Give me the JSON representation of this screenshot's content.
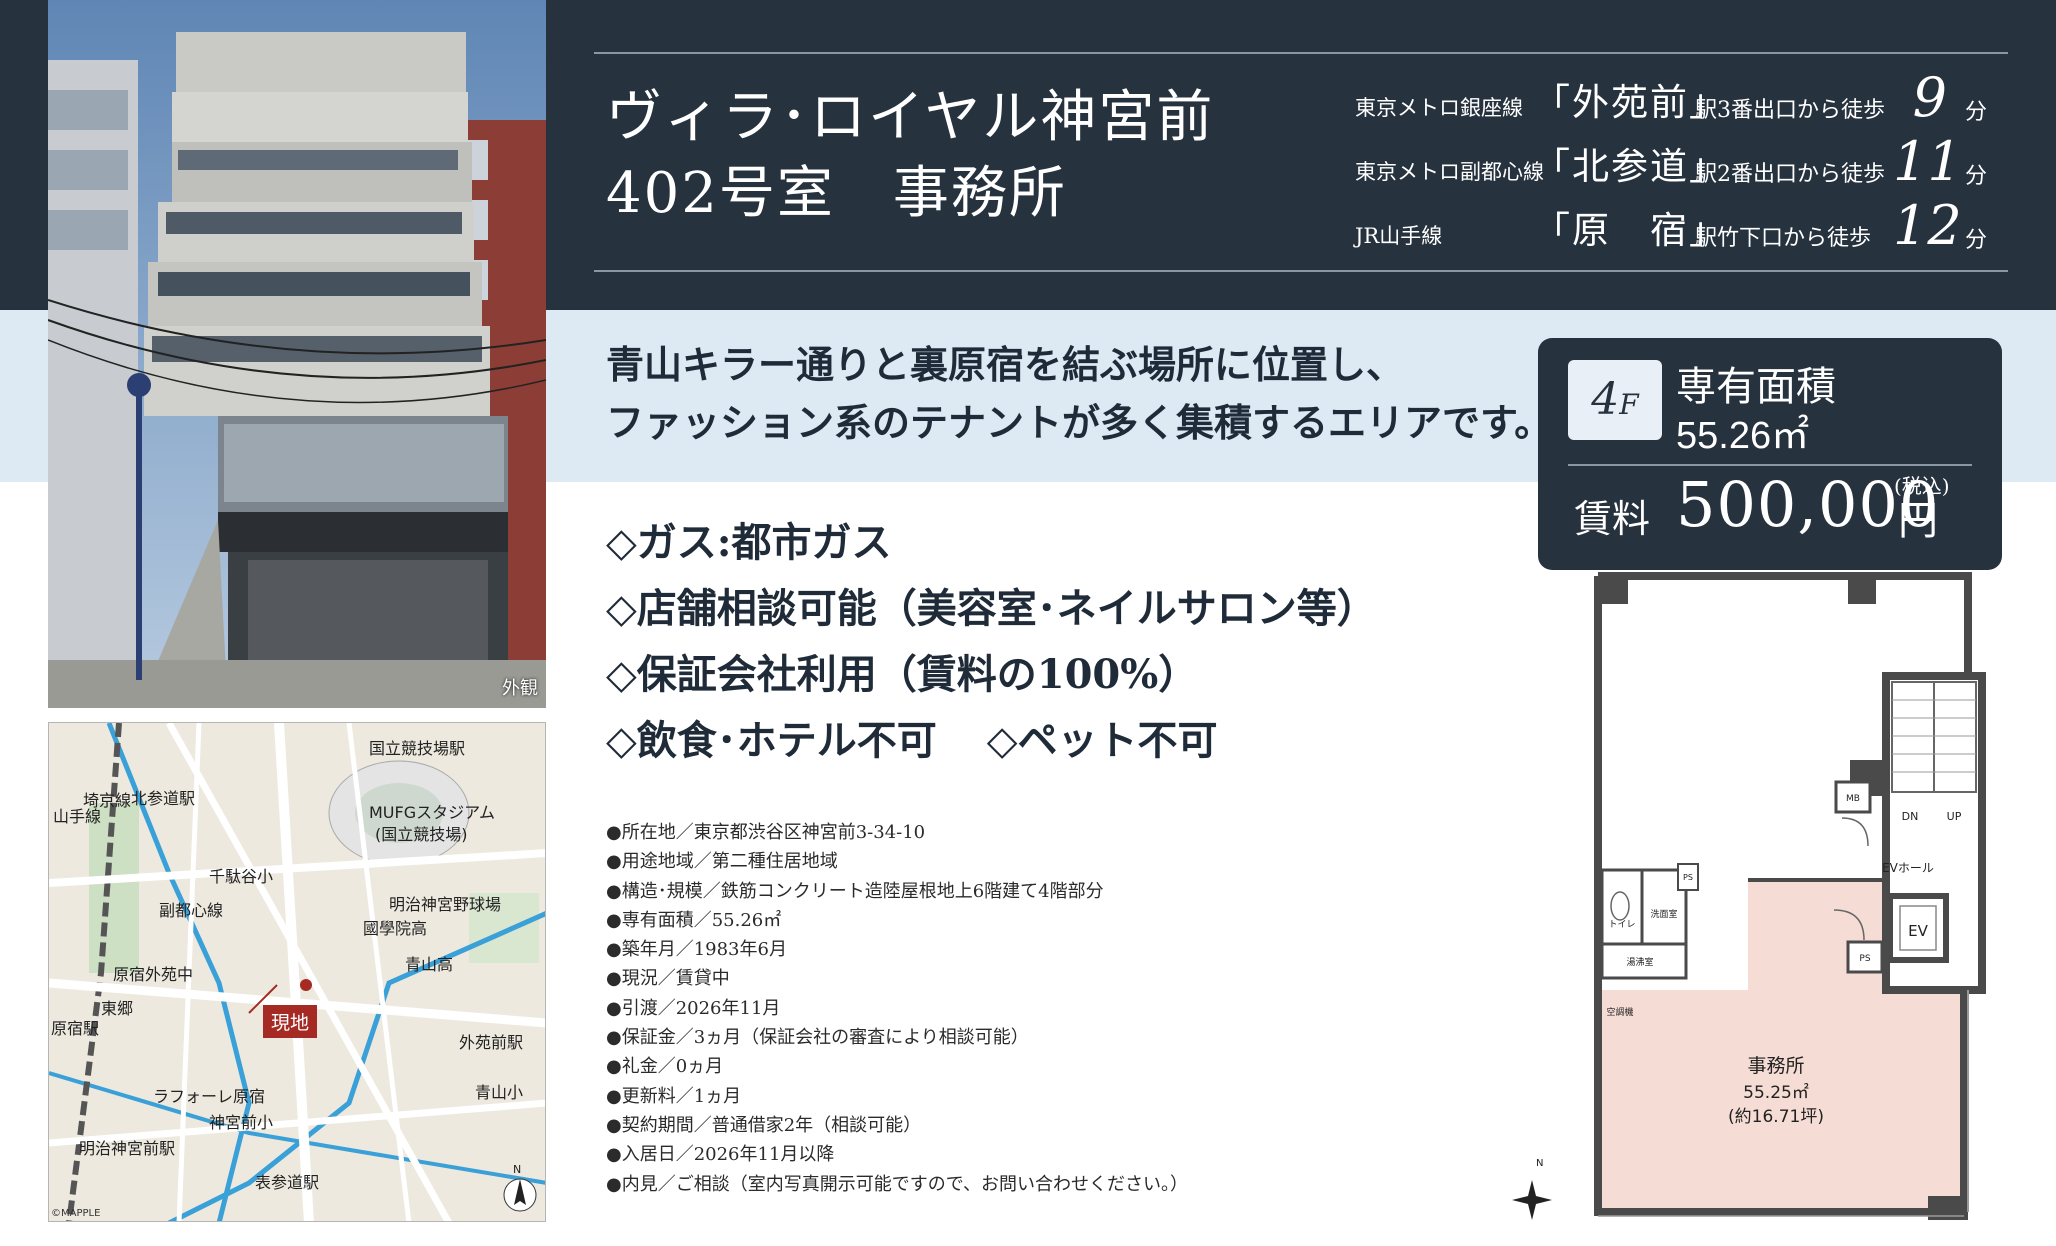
{
  "property": {
    "name_line1": "ヴィラ･ロイヤル神宮前",
    "name_line2": "402号室　事務所"
  },
  "access": [
    {
      "line": "東京メトロ銀座線",
      "station": "「外苑前」",
      "exit": "駅3番出口から徒歩",
      "minutes": "9",
      "unit": "分"
    },
    {
      "line": "東京メトロ副都心線",
      "station": "「北参道」",
      "exit": "駅2番出口から徒歩",
      "minutes": "11",
      "unit": "分"
    },
    {
      "line": "JR山手線",
      "station": "「原　宿」",
      "exit": "駅竹下口から徒歩",
      "minutes": "12",
      "unit": "分"
    }
  ],
  "photo_caption": "外観",
  "catchphrase": {
    "line1": "青山キラー通りと裏原宿を結ぶ場所に位置し、",
    "line2": "ファッション系のテナントが多く集積するエリアです。"
  },
  "features": [
    "◇ガス:都市ガス",
    "◇店舗相談可能（美容室･ネイルサロン等）",
    "◇保証会社利用（賃料の100%）",
    "◇飲食･ホテル不可",
    "◇ペット不可"
  ],
  "details": [
    "●所在地／東京都渋谷区神宮前3-34-10",
    "●用途地域／第二種住居地域",
    "●構造･規模／鉄筋コンクリート造陸屋根地上6階建て4階部分",
    "●専有面積／55.26㎡",
    "●築年月／1983年6月",
    "●現況／賃貸中",
    "●引渡／2026年11月",
    "●保証金／3ヵ月（保証会社の審査により相談可能）",
    "●礼金／0ヵ月",
    "●更新料／1ヵ月",
    "●契約期間／普通借家2年（相談可能）",
    "●入居日／2026年11月以降",
    "●内見／ご相談（室内写真開示可能ですので、お問い合わせください。）"
  ],
  "price_box": {
    "floor_num": "4",
    "floor_unit": "F",
    "area_label": "専有面積",
    "area_value": "55.26㎡",
    "rent_label": "賃料",
    "rent_value": "500,000",
    "rent_unit": "円",
    "tax_note": "(税込)"
  },
  "floor_plan": {
    "office_label": "事務所",
    "office_area": "55.25㎡",
    "office_tsubo": "(約16.71坪)",
    "ev": "EV",
    "ev_hall": "EVホール",
    "dn": "DN",
    "up": "UP",
    "mb": "MB",
    "ps": "PS",
    "toilet": "トイレ",
    "washroom": "洗面室",
    "kitchenette": "湯沸室",
    "aircon": "空調機",
    "ps_small": "PS",
    "north": "N"
  },
  "map": {
    "labels": [
      "国立競技場駅",
      "MUFGスタジアム",
      "(国立競技場)",
      "明治神宮野球場",
      "國學院高",
      "青山高",
      "千駄谷小",
      "原宿外苑中",
      "東郷",
      "外苑前駅",
      "青山小",
      "ラフォーレ原宿",
      "神宮前小",
      "明治神宮前駅",
      "表参道駅",
      "北参道駅",
      "副都心線",
      "山手線",
      "埼京線",
      "原宿駅"
    ],
    "site": "現地",
    "credit": "©MAPPLE",
    "north": "N"
  },
  "colors": {
    "navy": "#27323f",
    "light_blue": "#dde9f3",
    "office_pink": "#f5dcd5"
  }
}
